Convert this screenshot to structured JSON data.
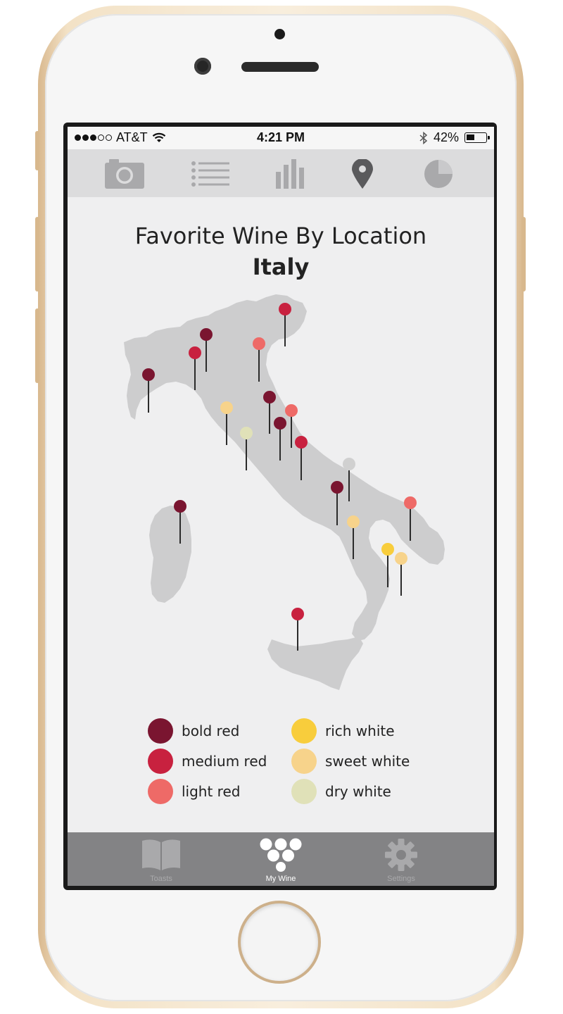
{
  "status_bar": {
    "carrier": "AT&T",
    "time": "4:21 PM",
    "battery_percent": "42%",
    "battery_level": 0.42,
    "signal_bars_filled": 3,
    "signal_bars_total": 5
  },
  "top_tabs": [
    {
      "icon": "camera-icon",
      "active": false
    },
    {
      "icon": "list-icon",
      "active": false
    },
    {
      "icon": "bar-chart-icon",
      "active": false
    },
    {
      "icon": "location-pin-icon",
      "active": true
    },
    {
      "icon": "pie-chart-icon",
      "active": false
    }
  ],
  "page": {
    "title": "Favorite Wine By Location",
    "subtitle": "Italy"
  },
  "colors": {
    "bold_red": "#7a1530",
    "medium_red": "#c8213f",
    "light_red": "#ee6a67",
    "rich_white": "#f8cd3c",
    "sweet_white": "#f7d38b",
    "dry_white": "#e0e1b8",
    "unknown": "#d0d0d0",
    "map_land": "#cdcdce"
  },
  "legend": [
    {
      "label": "bold red",
      "color": "#7a1530"
    },
    {
      "label": "medium red",
      "color": "#c8213f"
    },
    {
      "label": "light red",
      "color": "#ee6a67"
    },
    {
      "label": "rich white",
      "color": "#f8cd3c"
    },
    {
      "label": "sweet white",
      "color": "#f7d38b"
    },
    {
      "label": "dry white",
      "color": "#e0e1b8"
    }
  ],
  "pins": [
    {
      "region": "piedmont",
      "type": "bold red"
    },
    {
      "region": "lombardy-west",
      "type": "medium red"
    },
    {
      "region": "lombardy-east",
      "type": "bold red"
    },
    {
      "region": "veneto",
      "type": "light red"
    },
    {
      "region": "friuli",
      "type": "medium red"
    },
    {
      "region": "emilia",
      "type": "bold red"
    },
    {
      "region": "tuscany-north",
      "type": "sweet white"
    },
    {
      "region": "tuscany-south",
      "type": "dry white"
    },
    {
      "region": "marche-north",
      "type": "light red"
    },
    {
      "region": "marche",
      "type": "bold red"
    },
    {
      "region": "abruzzo",
      "type": "medium red"
    },
    {
      "region": "molise",
      "type": "unknown"
    },
    {
      "region": "campania",
      "type": "bold red"
    },
    {
      "region": "basilicata",
      "type": "sweet white"
    },
    {
      "region": "puglia",
      "type": "light red"
    },
    {
      "region": "calabria-north",
      "type": "rich white"
    },
    {
      "region": "calabria-east",
      "type": "sweet white"
    },
    {
      "region": "sardinia",
      "type": "bold red"
    },
    {
      "region": "sicily",
      "type": "medium red"
    }
  ],
  "bottom_tabs": [
    {
      "label": "Toasts",
      "icon": "book-icon",
      "active": false
    },
    {
      "label": "My Wine",
      "icon": "grapes-icon",
      "active": true
    },
    {
      "label": "Settings",
      "icon": "gear-icon",
      "active": false
    }
  ]
}
